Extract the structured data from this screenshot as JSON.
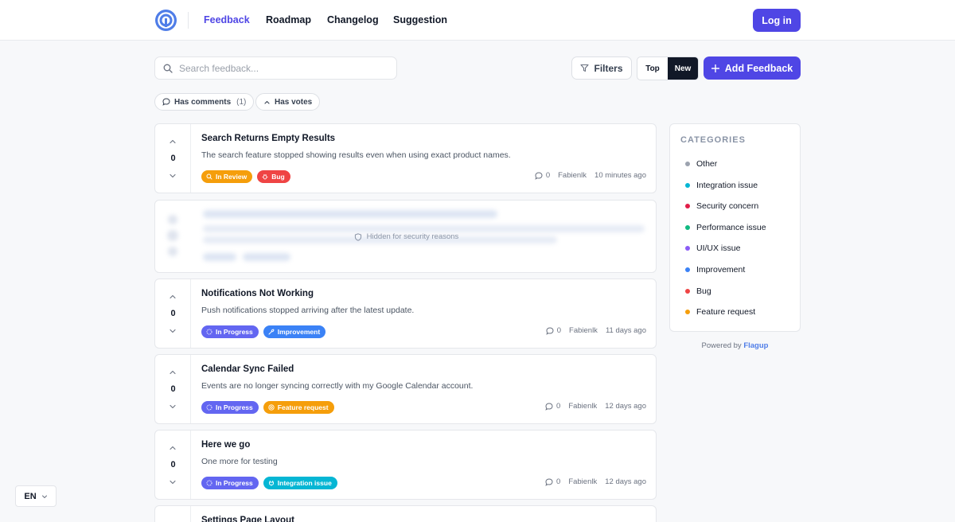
{
  "header": {
    "nav": [
      "Feedback",
      "Roadmap",
      "Changelog",
      "Suggestion"
    ],
    "login_label": "Log in"
  },
  "toolbar": {
    "search_placeholder": "Search feedback...",
    "filters_label": "Filters",
    "sort_top": "Top",
    "sort_new": "New",
    "add_label": "Add Feedback"
  },
  "chips": {
    "comments_label": "Has comments",
    "comments_count": "(1)",
    "votes_label": "Has votes"
  },
  "posts": [
    {
      "title": "Search Returns Empty Results",
      "description": "The search feature stopped showing results even when using exact product names.",
      "votes": "0",
      "status": "In Review",
      "category": "Bug",
      "comments": "0",
      "author": "Fabienlk",
      "time": "10 minutes ago"
    },
    {
      "title": "Notifications Not Working",
      "description": "Push notifications stopped arriving after the latest update.",
      "votes": "0",
      "status": "In Progress",
      "category": "Improvement",
      "comments": "0",
      "author": "Fabienlk",
      "time": "11 days ago"
    },
    {
      "title": "Calendar Sync Failed",
      "description": "Events are no longer syncing correctly with my Google Calendar account.",
      "votes": "0",
      "status": "In Progress",
      "category": "Feature request",
      "comments": "0",
      "author": "Fabienlk",
      "time": "12 days ago"
    },
    {
      "title": "Here we go",
      "description": "One more for testing",
      "votes": "0",
      "status": "In Progress",
      "category": "Integration issue",
      "comments": "0",
      "author": "Fabienlk",
      "time": "12 days ago"
    },
    {
      "title": "Settings Page Layout"
    }
  ],
  "hidden_post": {
    "label": "Hidden for security reasons"
  },
  "categories": {
    "title": "CATEGORIES",
    "items": [
      {
        "label": "Other",
        "color": "#9ca3af"
      },
      {
        "label": "Integration issue",
        "color": "#06b6d4"
      },
      {
        "label": "Security concern",
        "color": "#e11d48"
      },
      {
        "label": "Performance issue",
        "color": "#10b981"
      },
      {
        "label": "UI/UX issue",
        "color": "#8b5cf6"
      },
      {
        "label": "Improvement",
        "color": "#3b82f6"
      },
      {
        "label": "Bug",
        "color": "#ef4444"
      },
      {
        "label": "Feature request",
        "color": "#f59e0b"
      }
    ]
  },
  "footer": {
    "powered_prefix": "Powered by",
    "powered_brand": "Flagup"
  },
  "language": {
    "current": "EN"
  },
  "colors": {
    "accent": "#4f46e5",
    "status_in_review": "#f59e0b",
    "status_in_progress": "#6366f1",
    "tag_bug": "#ef4444",
    "tag_improvement": "#3b82f6",
    "tag_feature_request": "#f59e0b",
    "tag_integration_issue": "#06b6d4"
  },
  "icons": {
    "logo": "flagup-logo-icon",
    "search": "search-icon",
    "filter": "funnel-icon",
    "add": "plus-icon",
    "comment": "comment-icon",
    "vote_up": "chevron-up-icon",
    "vote_down": "chevron-down-icon",
    "shield": "shield-icon"
  }
}
